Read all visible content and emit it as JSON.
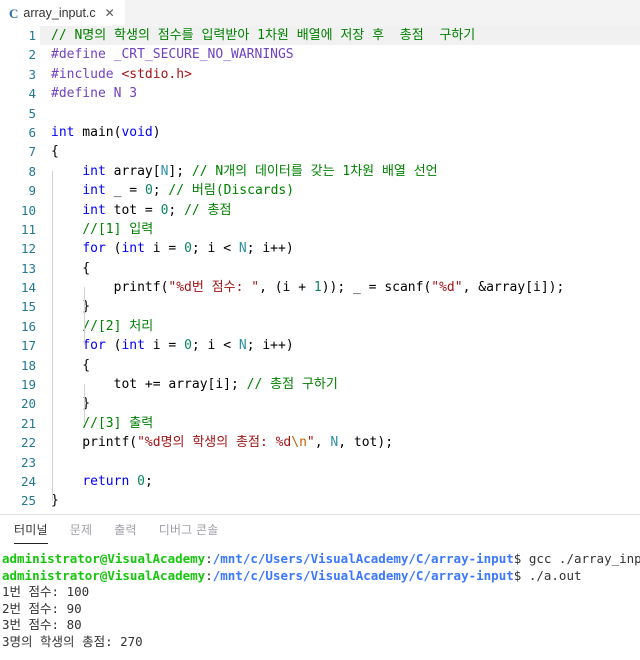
{
  "window": {
    "app": "vscode-editor",
    "accent_color": "#2d6ea8"
  },
  "tabbar": {
    "tabs": [
      {
        "icon": "c-file-icon",
        "icon_label": "C",
        "label": "array_input.c",
        "close_label": "✕",
        "active": true
      }
    ]
  },
  "editor": {
    "first_line": 1,
    "last_line": 25,
    "lines": [
      {
        "n": "1",
        "tokens": [
          {
            "t": "cmt",
            "s": "// N명의 학생의 점수를 입력받아 1차원 배열에 저장 후  총점  구하기"
          }
        ],
        "highlight": true
      },
      {
        "n": "2",
        "tokens": [
          {
            "t": "pp",
            "s": "#define _CRT_SECURE_NO_WARNINGS"
          }
        ]
      },
      {
        "n": "3",
        "tokens": [
          {
            "t": "pp",
            "s": "#include "
          },
          {
            "t": "hdr",
            "s": "<stdio.h>"
          }
        ]
      },
      {
        "n": "4",
        "tokens": [
          {
            "t": "pp",
            "s": "#define N 3"
          }
        ]
      },
      {
        "n": "5",
        "tokens": []
      },
      {
        "n": "6",
        "tokens": [
          {
            "t": "kw",
            "s": "int"
          },
          {
            "t": "pln",
            "s": " main("
          },
          {
            "t": "kw",
            "s": "void"
          },
          {
            "t": "pln",
            "s": ")"
          }
        ]
      },
      {
        "n": "7",
        "tokens": [
          {
            "t": "pln",
            "s": "{"
          }
        ]
      },
      {
        "n": "8",
        "tokens": [
          {
            "t": "pln",
            "s": "    "
          },
          {
            "t": "kw",
            "s": "int"
          },
          {
            "t": "pln",
            "s": " array["
          },
          {
            "t": "mac",
            "s": "N"
          },
          {
            "t": "pln",
            "s": "]; "
          },
          {
            "t": "cmt",
            "s": "// N개의 데이터를 갖는 1차원 배열 선언"
          }
        ]
      },
      {
        "n": "9",
        "tokens": [
          {
            "t": "pln",
            "s": "    "
          },
          {
            "t": "kw",
            "s": "int"
          },
          {
            "t": "pln",
            "s": " _ = "
          },
          {
            "t": "num",
            "s": "0"
          },
          {
            "t": "pln",
            "s": "; "
          },
          {
            "t": "cmt",
            "s": "// 버림(Discards)"
          }
        ]
      },
      {
        "n": "10",
        "tokens": [
          {
            "t": "pln",
            "s": "    "
          },
          {
            "t": "kw",
            "s": "int"
          },
          {
            "t": "pln",
            "s": " tot = "
          },
          {
            "t": "num",
            "s": "0"
          },
          {
            "t": "pln",
            "s": "; "
          },
          {
            "t": "cmt",
            "s": "// 총점"
          }
        ]
      },
      {
        "n": "11",
        "tokens": [
          {
            "t": "pln",
            "s": "    "
          },
          {
            "t": "cmt",
            "s": "//[1] 입력"
          }
        ]
      },
      {
        "n": "12",
        "tokens": [
          {
            "t": "pln",
            "s": "    "
          },
          {
            "t": "kw",
            "s": "for"
          },
          {
            "t": "pln",
            "s": " ("
          },
          {
            "t": "kw",
            "s": "int"
          },
          {
            "t": "pln",
            "s": " i = "
          },
          {
            "t": "num",
            "s": "0"
          },
          {
            "t": "pln",
            "s": "; i < "
          },
          {
            "t": "mac",
            "s": "N"
          },
          {
            "t": "pln",
            "s": "; i++)"
          }
        ]
      },
      {
        "n": "13",
        "tokens": [
          {
            "t": "pln",
            "s": "    {"
          }
        ]
      },
      {
        "n": "14",
        "tokens": [
          {
            "t": "pln",
            "s": "        printf("
          },
          {
            "t": "str",
            "s": "\"%d번 점수: \""
          },
          {
            "t": "pln",
            "s": ", (i + "
          },
          {
            "t": "num",
            "s": "1"
          },
          {
            "t": "pln",
            "s": ")); _ = scanf("
          },
          {
            "t": "str",
            "s": "\"%d\""
          },
          {
            "t": "pln",
            "s": ", &array[i]);"
          }
        ]
      },
      {
        "n": "15",
        "tokens": [
          {
            "t": "pln",
            "s": "    }"
          }
        ]
      },
      {
        "n": "16",
        "tokens": [
          {
            "t": "pln",
            "s": "    "
          },
          {
            "t": "cmt",
            "s": "//[2] 처리"
          }
        ]
      },
      {
        "n": "17",
        "tokens": [
          {
            "t": "pln",
            "s": "    "
          },
          {
            "t": "kw",
            "s": "for"
          },
          {
            "t": "pln",
            "s": " ("
          },
          {
            "t": "kw",
            "s": "int"
          },
          {
            "t": "pln",
            "s": " i = "
          },
          {
            "t": "num",
            "s": "0"
          },
          {
            "t": "pln",
            "s": "; i < "
          },
          {
            "t": "mac",
            "s": "N"
          },
          {
            "t": "pln",
            "s": "; i++)"
          }
        ]
      },
      {
        "n": "18",
        "tokens": [
          {
            "t": "pln",
            "s": "    {"
          }
        ]
      },
      {
        "n": "19",
        "tokens": [
          {
            "t": "pln",
            "s": "        tot += array[i]; "
          },
          {
            "t": "cmt",
            "s": "// 총점 구하기"
          }
        ]
      },
      {
        "n": "20",
        "tokens": [
          {
            "t": "pln",
            "s": "    }"
          }
        ]
      },
      {
        "n": "21",
        "tokens": [
          {
            "t": "pln",
            "s": "    "
          },
          {
            "t": "cmt",
            "s": "//[3] 출력"
          }
        ]
      },
      {
        "n": "22",
        "tokens": [
          {
            "t": "pln",
            "s": "    printf("
          },
          {
            "t": "str",
            "s": "\"%d명의 학생의 총점: %d"
          },
          {
            "t": "esc",
            "s": "\\n"
          },
          {
            "t": "str",
            "s": "\""
          },
          {
            "t": "pln",
            "s": ", "
          },
          {
            "t": "mac",
            "s": "N"
          },
          {
            "t": "pln",
            "s": ", tot);"
          }
        ]
      },
      {
        "n": "23",
        "tokens": []
      },
      {
        "n": "24",
        "tokens": [
          {
            "t": "pln",
            "s": "    "
          },
          {
            "t": "kw",
            "s": "return"
          },
          {
            "t": "pln",
            "s": " "
          },
          {
            "t": "num",
            "s": "0"
          },
          {
            "t": "pln",
            "s": ";"
          }
        ]
      },
      {
        "n": "25",
        "tokens": [
          {
            "t": "pln",
            "s": "}"
          }
        ]
      }
    ]
  },
  "panel": {
    "tabs": [
      {
        "label": "터미널",
        "active": true
      },
      {
        "label": "문제",
        "active": false
      },
      {
        "label": "출력",
        "active": false
      },
      {
        "label": "디버그 콘솔",
        "active": false
      }
    ],
    "terminal": {
      "prompt_user": "administrator@VisualAcademy",
      "prompt_path": "/mnt/c/Users/VisualAcademy/C/array-input",
      "prompt_symbol": "$",
      "lines": [
        {
          "type": "prompt",
          "command": " gcc ./array_input.c"
        },
        {
          "type": "prompt",
          "command": " ./a.out"
        },
        {
          "type": "output",
          "text": "1번 점수: 100"
        },
        {
          "type": "output",
          "text": "2번 점수: 90"
        },
        {
          "type": "output",
          "text": "3번 점수: 80"
        },
        {
          "type": "output",
          "text": "3명의 학생의 총점: 270"
        }
      ]
    }
  },
  "colors": {
    "comment": "#008000",
    "preprocessor": "#6f42c1",
    "string": "#a31515",
    "keyword": "#0000ff",
    "macro": "#2b91af",
    "number": "#098658",
    "linenumber": "#237893",
    "terminal_user": "#16c60c",
    "terminal_path": "#3b78ff"
  }
}
